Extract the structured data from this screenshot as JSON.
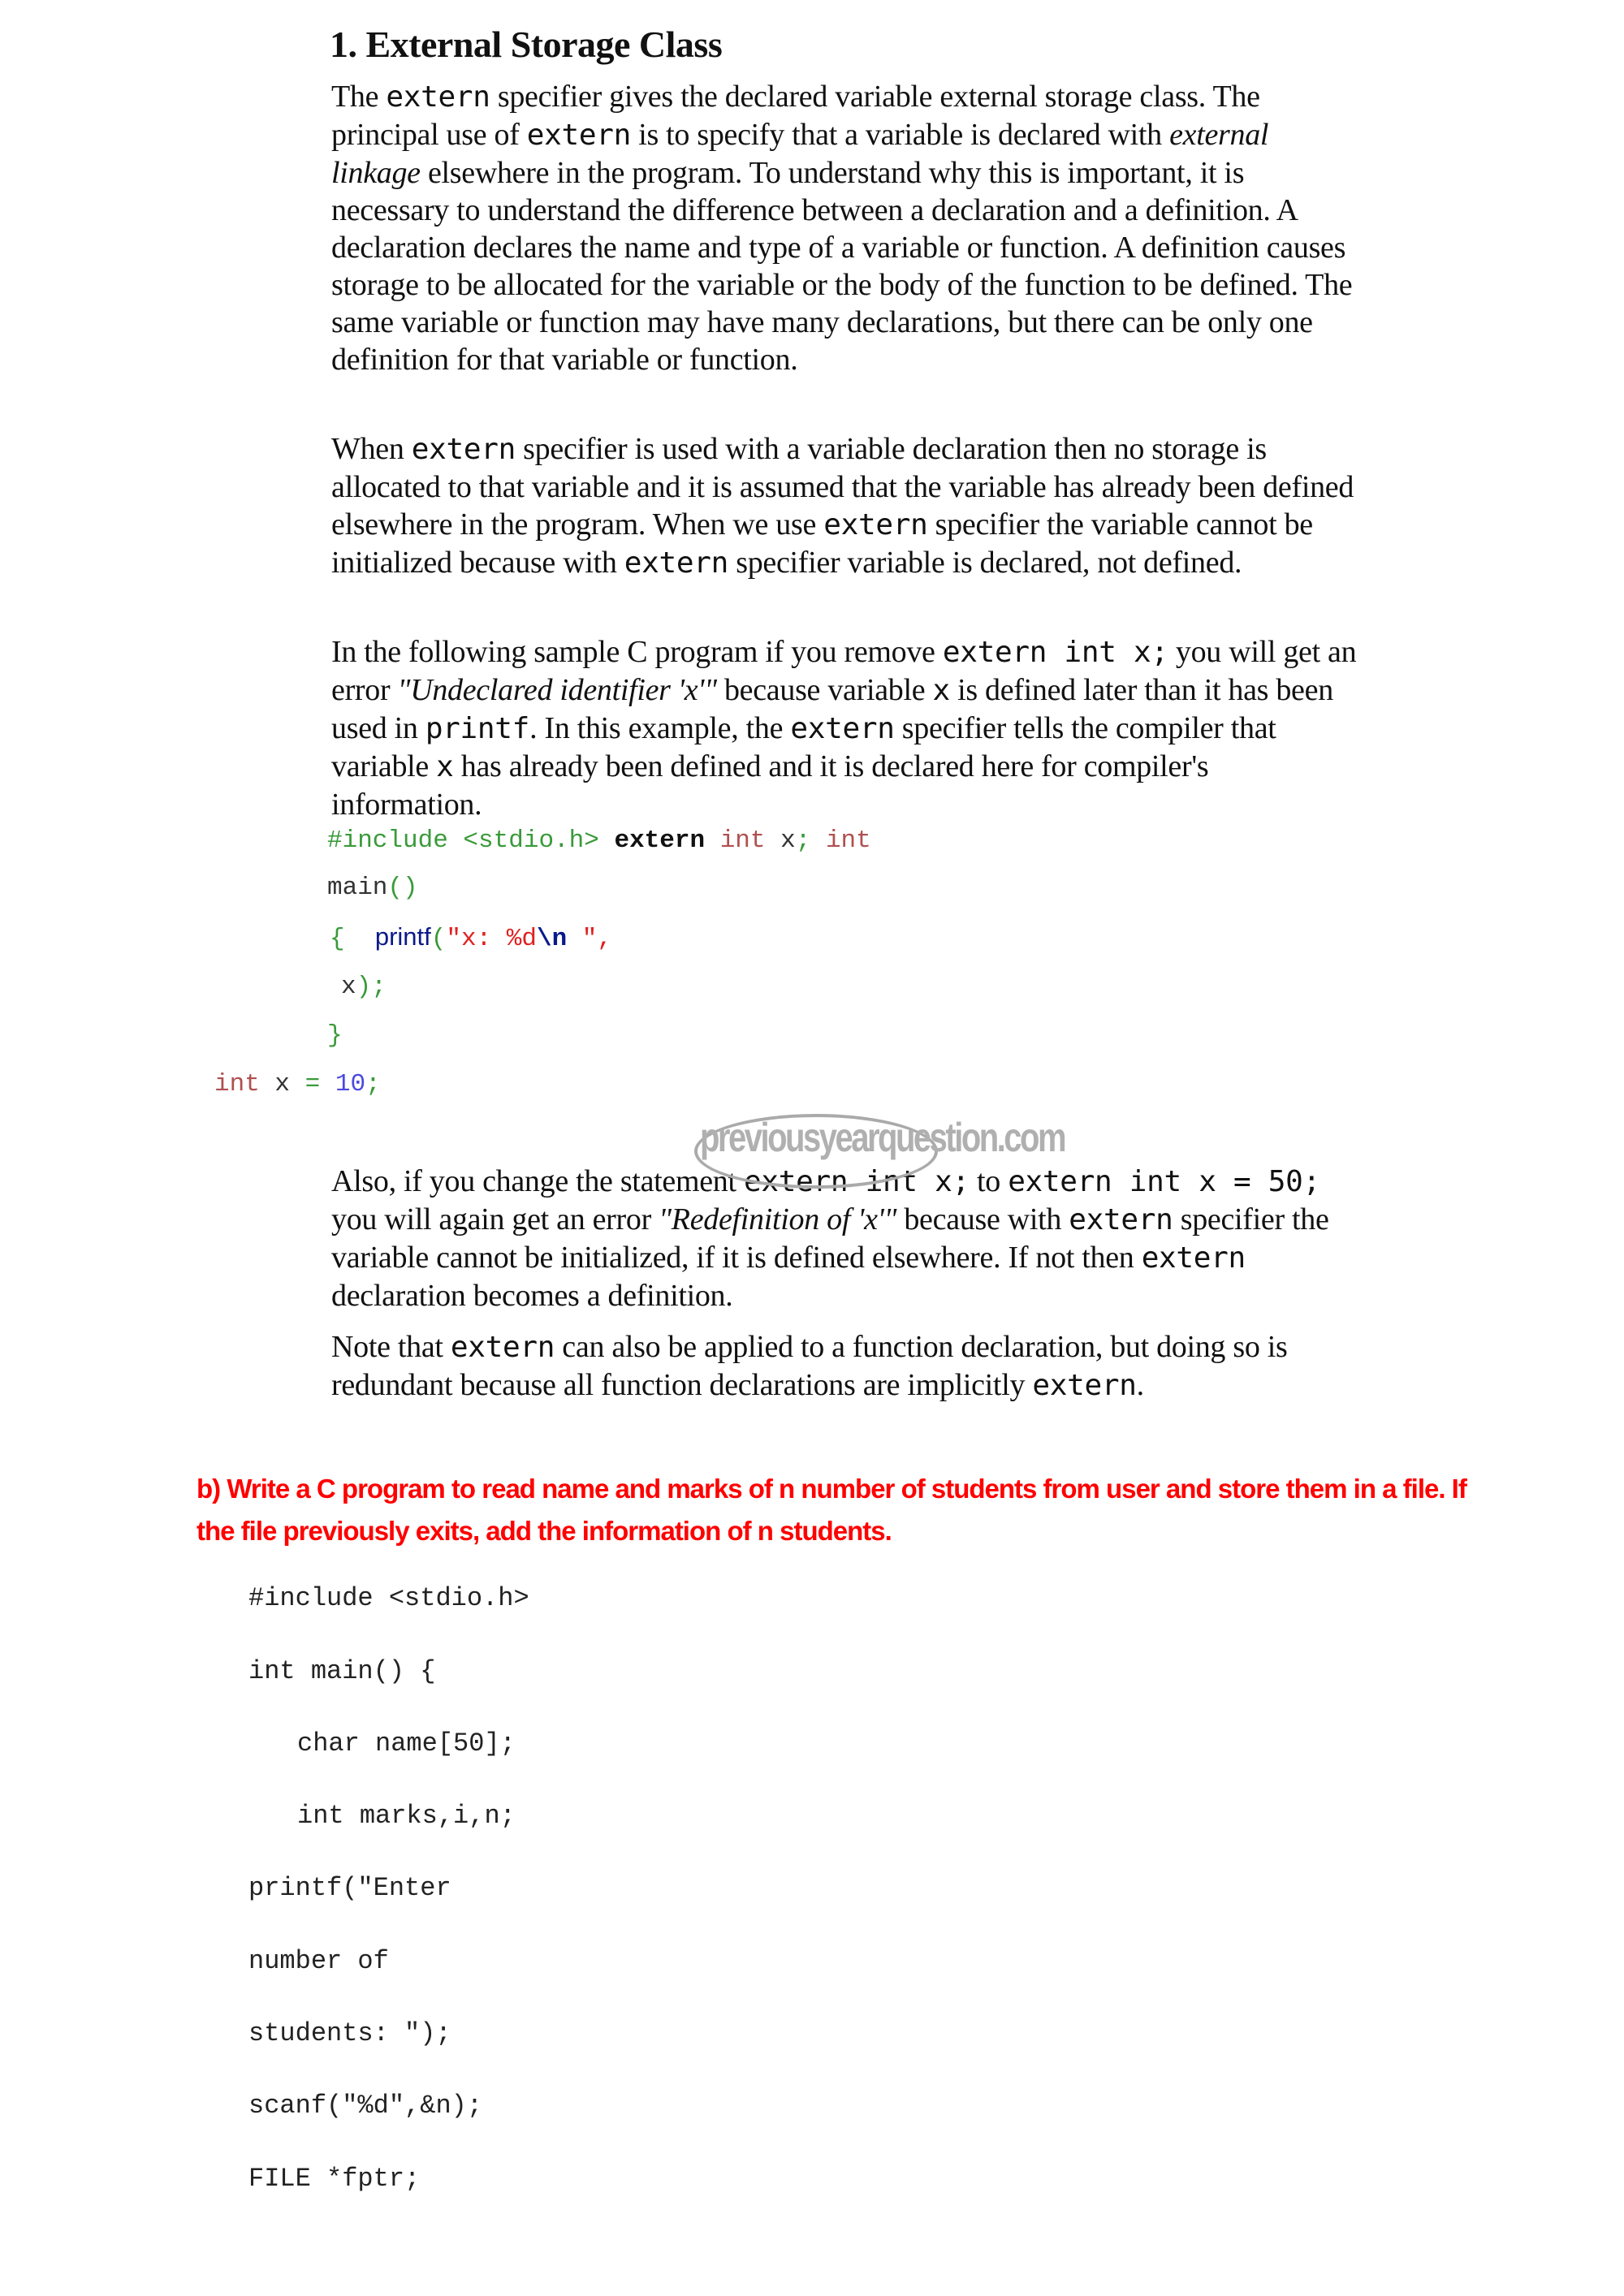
{
  "section1": {
    "heading": "1. External Storage Class",
    "p1": {
      "a": "The ",
      "kw1": "extern",
      "b": "  specifier gives the declared variable external storage class. The principal use of ",
      "kw2": "extern",
      "c": "  is to specify that a variable is declared with ",
      "italic": "external linkage",
      "d": " elsewhere in the program. To understand why this is important, it is necessary to understand the difference between a declaration and a definition. A declaration declares the name and type of a variable or function. A definition causes storage to be allocated for the variable or the body of the function to be defined. The same variable or function may have many declarations, but there can be only one definition for that variable or function."
    },
    "p2": {
      "a": "When ",
      "kw1": "extern",
      "b": "  specifier is used with a variable declaration then no storage is allocated to that variable and it is assumed that the variable has already been defined elsewhere in the program. When we use ",
      "kw2": "extern",
      "c": " specifier the variable cannot be initialized because with ",
      "kw3": "extern",
      "d": "  specifier variable is declared, not defined."
    },
    "p3": {
      "a": "In the following sample C program if you remove ",
      "code1": "extern int x;",
      "b": "  you will get an error ",
      "italic": "\"Undeclared identifier 'x'\"",
      "c": " because variable ",
      "code2": "x",
      "d": "  is defined later than it has been used in ",
      "code3": "printf",
      "e": ". In this example, the ",
      "code4": "extern",
      "f": " specifier tells the compiler that variable ",
      "code5": "x",
      "g": "  has already been defined and it is declared here for compiler's information."
    },
    "sample_code": {
      "line1_include": "#include <stdio.h>",
      "line1_extern": "extern",
      "line1_int": "int",
      "line1_x": "x",
      "line1_semi": ";",
      "line1_int2": "int",
      "line2_main": "main",
      "line2_parens": "()",
      "line3_brace": "{",
      "line3_printf": "printf",
      "line3_paren": "(",
      "line3_str": "\"x: %d",
      "line3_esc": "\\n",
      "line3_strend": " \",",
      "line4_x": "x",
      "line4_end": ");",
      "line5_brace": "}",
      "line6_int": "int",
      "line6_x": "x",
      "line6_eq": "=",
      "line6_num": "10",
      "line6_semi": ";"
    },
    "p4": {
      "a": "Also, if you change the statement ",
      "code1": "extern int x;",
      "b": "  to ",
      "code2": "extern int x = 50;",
      "c": "  you will again get an error ",
      "italic": "\"Redefinition of 'x'\"",
      "d": " because with ",
      "code3": "extern",
      "e": "  specifier the variable cannot be initialized, if it is defined elsewhere. If not then ",
      "code4": "extern",
      "f": "  declaration becomes a definition."
    },
    "p5": {
      "a": "Note that ",
      "code1": "extern",
      "b": "  can also be applied to a function declaration, but doing so is redundant because all function declarations are implicitly ",
      "code2": "extern",
      "c": "."
    }
  },
  "watermark": "previousyearquestion.com",
  "question_b": {
    "text": "b) Write a C program to read name and marks of n number of students from user and store them in a file. If the file previously exits, add the information of n students.",
    "color": "#ff0000"
  },
  "program_b": {
    "lines": [
      "#include <stdio.h>",
      "int main() {",
      "char name[50];",
      "int marks,i,n;",
      "printf(\"Enter",
      "number of",
      "students: \");",
      "scanf(\"%d\",&n);",
      "FILE *fptr;"
    ]
  }
}
